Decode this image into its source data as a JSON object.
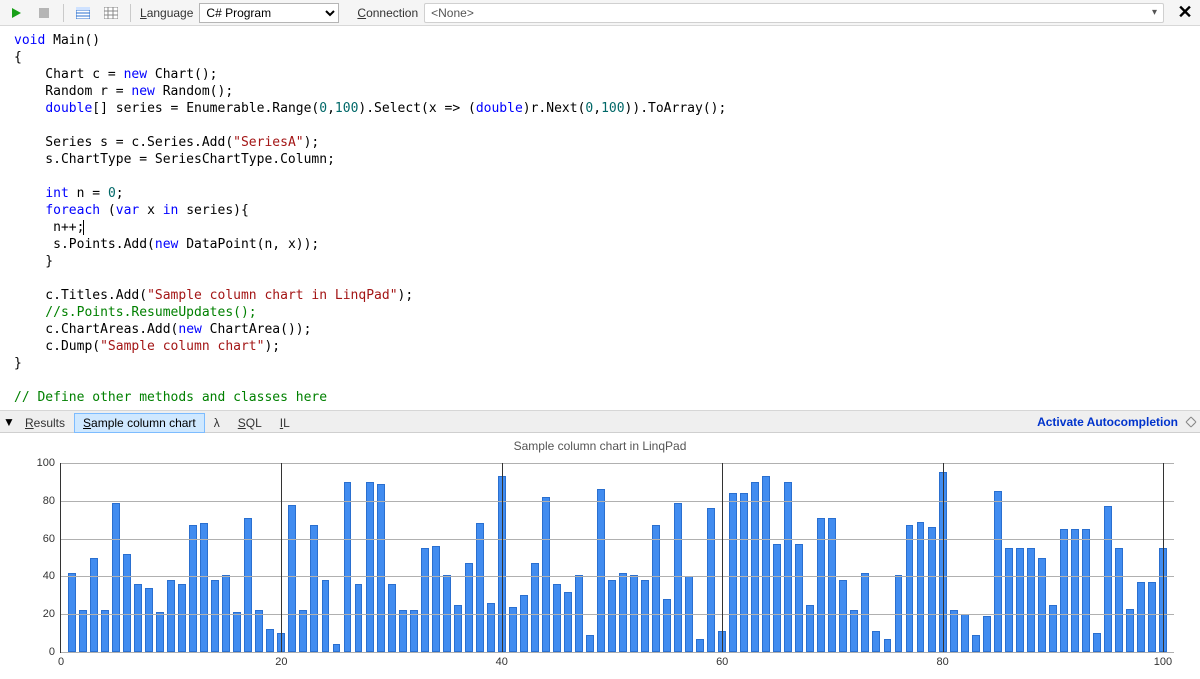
{
  "toolbar": {
    "language_label": "Language",
    "language_value": "C# Program",
    "connection_label": "Connection",
    "connection_value": "<None>"
  },
  "code_tokens": [
    [
      {
        "t": "void",
        "c": "kw"
      },
      {
        "t": " Main()"
      }
    ],
    [
      {
        "t": "{"
      }
    ],
    [
      {
        "t": "    Chart c = "
      },
      {
        "t": "new",
        "c": "kw"
      },
      {
        "t": " Chart();"
      }
    ],
    [
      {
        "t": "    Random r = "
      },
      {
        "t": "new",
        "c": "kw"
      },
      {
        "t": " Random();"
      }
    ],
    [
      {
        "t": "    "
      },
      {
        "t": "double",
        "c": "typ"
      },
      {
        "t": "[] series = Enumerable.Range("
      },
      {
        "t": "0",
        "c": "num"
      },
      {
        "t": ","
      },
      {
        "t": "100",
        "c": "num"
      },
      {
        "t": ").Select(x => ("
      },
      {
        "t": "double",
        "c": "typ"
      },
      {
        "t": ")r.Next("
      },
      {
        "t": "0",
        "c": "num"
      },
      {
        "t": ","
      },
      {
        "t": "100",
        "c": "num"
      },
      {
        "t": ")).ToArray();"
      }
    ],
    [
      {
        "t": " "
      }
    ],
    [
      {
        "t": "    Series s = c.Series.Add("
      },
      {
        "t": "\"SeriesA\"",
        "c": "str"
      },
      {
        "t": ");"
      }
    ],
    [
      {
        "t": "    s.ChartType = SeriesChartType.Column;"
      }
    ],
    [
      {
        "t": " "
      }
    ],
    [
      {
        "t": "    "
      },
      {
        "t": "int",
        "c": "typ"
      },
      {
        "t": " n = "
      },
      {
        "t": "0",
        "c": "num"
      },
      {
        "t": ";"
      }
    ],
    [
      {
        "t": "    "
      },
      {
        "t": "foreach",
        "c": "kw"
      },
      {
        "t": " ("
      },
      {
        "t": "var",
        "c": "kw"
      },
      {
        "t": " x "
      },
      {
        "t": "in",
        "c": "kw"
      },
      {
        "t": " series){"
      }
    ],
    [
      {
        "t": "     n++;"
      },
      {
        "t": "",
        "caret": true
      }
    ],
    [
      {
        "t": "     s.Points.Add("
      },
      {
        "t": "new",
        "c": "kw"
      },
      {
        "t": " DataPoint(n, x));"
      }
    ],
    [
      {
        "t": "    }"
      }
    ],
    [
      {
        "t": " "
      }
    ],
    [
      {
        "t": "    c.Titles.Add("
      },
      {
        "t": "\"Sample column chart in LinqPad\"",
        "c": "str"
      },
      {
        "t": ");"
      }
    ],
    [
      {
        "t": "    //s.Points.ResumeUpdates();",
        "c": "com"
      }
    ],
    [
      {
        "t": "    c.ChartAreas.Add("
      },
      {
        "t": "new",
        "c": "kw"
      },
      {
        "t": " ChartArea());"
      }
    ],
    [
      {
        "t": "    c.Dump("
      },
      {
        "t": "\"Sample column chart\"",
        "c": "str"
      },
      {
        "t": ");"
      }
    ],
    [
      {
        "t": "}"
      }
    ],
    [
      {
        "t": " "
      }
    ],
    [
      {
        "t": "// Define other methods and classes here",
        "c": "com"
      }
    ]
  ],
  "tabs": {
    "items": [
      "Results",
      "Sample column chart",
      "λ",
      "SQL",
      "IL"
    ],
    "active_index": 1,
    "activate_label": "Activate Autocompletion"
  },
  "chart_data": {
    "type": "bar",
    "title": "Sample column chart in LinqPad",
    "xlabel": "",
    "ylabel": "",
    "ylim": [
      0,
      100
    ],
    "yticks": [
      0,
      20,
      40,
      60,
      80,
      100
    ],
    "xticks": [
      0,
      20,
      40,
      60,
      80,
      100
    ],
    "categories_start": 1,
    "values": [
      42,
      22,
      50,
      22,
      79,
      52,
      36,
      34,
      21,
      38,
      36,
      67,
      68,
      38,
      41,
      21,
      71,
      22,
      12,
      10,
      78,
      22,
      67,
      38,
      4,
      90,
      36,
      90,
      89,
      36,
      22,
      22,
      55,
      56,
      41,
      25,
      47,
      68,
      26,
      93,
      24,
      30,
      47,
      82,
      36,
      32,
      41,
      9,
      86,
      38,
      42,
      41,
      38,
      67,
      28,
      79,
      40,
      7,
      76,
      11,
      84,
      84,
      90,
      93,
      57,
      90,
      57,
      25,
      71,
      71,
      38,
      22,
      42,
      11,
      7,
      41,
      67,
      69,
      66,
      95,
      22,
      20,
      9,
      19,
      85,
      55,
      55,
      55,
      50,
      25,
      65,
      65,
      65,
      10,
      77,
      55,
      23,
      37,
      37,
      55
    ]
  },
  "colors": {
    "bar": "#418cf0"
  }
}
